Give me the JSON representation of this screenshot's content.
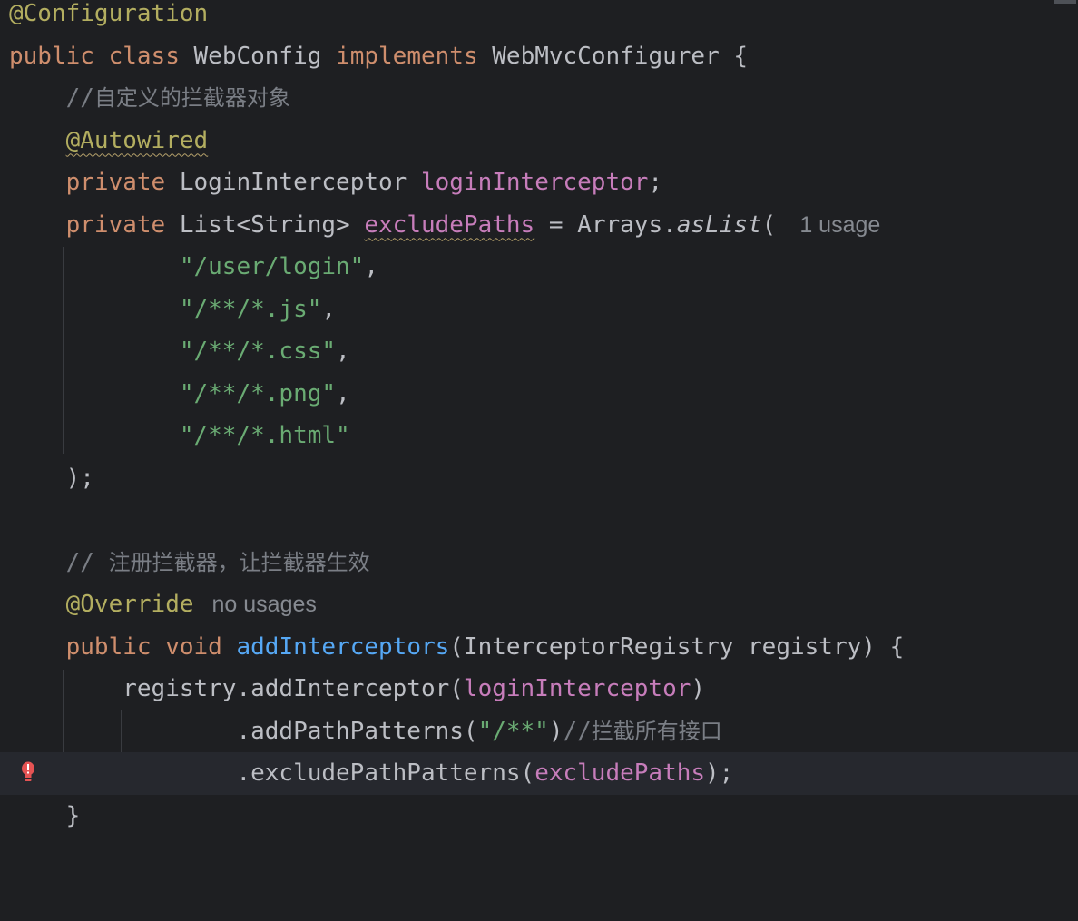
{
  "colors": {
    "background": "#1e1f22",
    "keyword": "#cf8e6d",
    "annotation": "#b3ae60",
    "field": "#c77dbb",
    "string": "#6aab73",
    "method_decl": "#56a8f5",
    "comment": "#7a7e85",
    "text": "#bcbec4",
    "inlay_hint": "#868a91",
    "error_bulb": "#e55353"
  },
  "code": {
    "l1": {
      "annotation": "@Configuration"
    },
    "l2": {
      "kw_public": "public",
      "kw_class": "class",
      "class_name": "WebConfig",
      "kw_implements": "implements",
      "interface_name": "WebMvcConfigurer",
      "brace": "{"
    },
    "l3": {
      "comment_prefix": "//",
      "comment_text": "自定义的拦截器对象"
    },
    "l4": {
      "annotation": "@Autowired"
    },
    "l5": {
      "kw_private": "private",
      "type": "LoginInterceptor",
      "field": "loginInterceptor",
      "semicolon": ";"
    },
    "l6": {
      "kw_private": "private",
      "type": "List<String>",
      "field": "excludePaths",
      "assign": "=",
      "call_obj": "Arrays.",
      "call_method": "asList",
      "paren": "(",
      "hint": "1 usage"
    },
    "strings": [
      {
        "value": "\"/user/login\"",
        "suffix": ","
      },
      {
        "value": "\"/**/*.js\"",
        "suffix": ","
      },
      {
        "value": "\"/**/*.css\"",
        "suffix": ","
      },
      {
        "value": "\"/**/*.png\"",
        "suffix": ","
      },
      {
        "value": "\"/**/*.html\"",
        "suffix": ""
      }
    ],
    "l12": {
      "text": ");"
    },
    "l14": {
      "comment_prefix": "//",
      "comment_text": "注册拦截器，让拦截器生效"
    },
    "l15": {
      "annotation": "@Override",
      "hint": "no usages"
    },
    "l16": {
      "kw_public": "public",
      "kw_void": "void",
      "method": "addInterceptors",
      "open": "(",
      "param_type": "InterceptorRegistry",
      "param_name": "registry",
      "close": ") {"
    },
    "l17": {
      "call": "registry.addInterceptor(",
      "field": "loginInterceptor",
      "close": ")"
    },
    "l18": {
      "call": ".addPathPatterns(",
      "str": "\"/**\"",
      "close": ")",
      "comment_prefix": "//",
      "comment_text": "拦截所有接口"
    },
    "l19": {
      "call": ".excludePathPatterns(",
      "field": "excludePaths",
      "close": ");"
    },
    "l20": {
      "text": "}"
    }
  },
  "gutter": {
    "error_icon": "red-bulb-icon"
  }
}
